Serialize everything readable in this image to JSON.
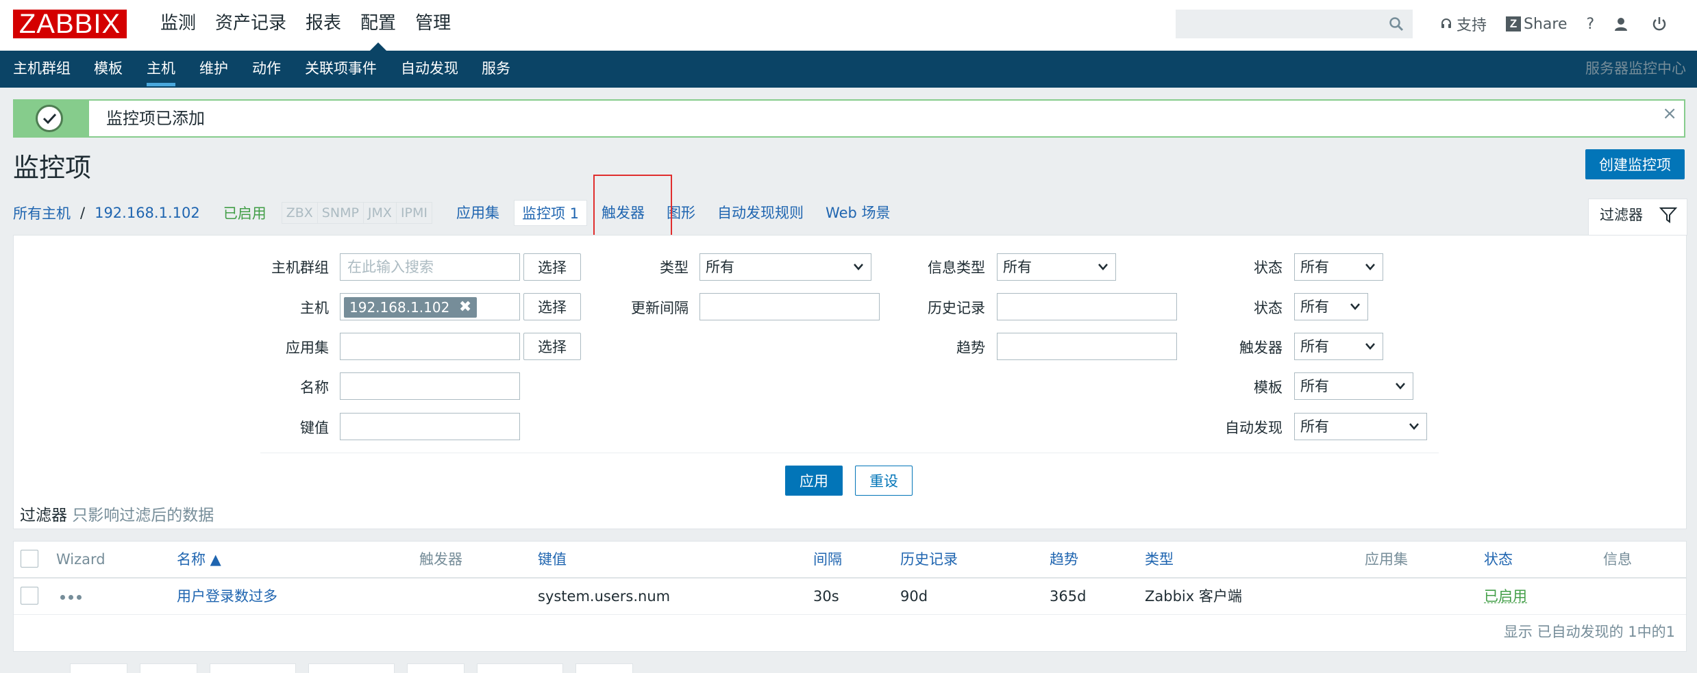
{
  "topbar": {
    "logo": "ZABBIX",
    "menu": [
      "监测",
      "资产记录",
      "报表",
      "配置",
      "管理"
    ],
    "search_placeholder": "",
    "support": "支持",
    "share": "Share",
    "help": "?"
  },
  "subnav": {
    "items": [
      "主机群组",
      "模板",
      "主机",
      "维护",
      "动作",
      "关联项事件",
      "自动发现",
      "服务"
    ],
    "active": "主机",
    "server": "服务器监控中心"
  },
  "message": {
    "text": "监控项已添加",
    "close": "×"
  },
  "page": {
    "title": "监控项",
    "create_button": "创建监控项"
  },
  "crumbs": {
    "all_hosts": "所有主机",
    "sep": "/",
    "host": "192.168.1.102",
    "enabled": "已启用",
    "protocols": [
      "ZBX",
      "SNMP",
      "JMX",
      "IPMI"
    ],
    "tabs": [
      "应用集",
      "监控项 1",
      "触发器",
      "图形",
      "自动发现规则",
      "Web 场景"
    ],
    "filter_tab": "过滤器"
  },
  "filter": {
    "host_group_label": "主机群组",
    "host_group_placeholder": "在此输入搜索",
    "select": "选择",
    "host_label": "主机",
    "host_chip": "192.168.1.102",
    "host_chip_remove": "✖",
    "app_label": "应用集",
    "name_label": "名称",
    "key_label": "键值",
    "type_label": "类型",
    "type_value": "所有",
    "interval_label": "更新间隔",
    "info_type_label": "信息类型",
    "info_type_value": "所有",
    "history_label": "历史记录",
    "trends_label": "趋势",
    "state_label": "状态",
    "state_value": "所有",
    "status_label": "状态",
    "status_value": "所有",
    "triggers_label": "触发器",
    "triggers_value": "所有",
    "template_label": "模板",
    "template_value": "所有",
    "discovery_label": "自动发现",
    "discovery_value": "所有",
    "apply": "应用",
    "reset": "重设",
    "note_bold": "过滤器",
    "note_rest": " 只影响过滤后的数据"
  },
  "table": {
    "headers": {
      "wizard": "Wizard",
      "name": "名称 ▲",
      "triggers": "触发器",
      "key": "键值",
      "interval": "间隔",
      "history": "历史记录",
      "trends": "趋势",
      "type": "类型",
      "applications": "应用集",
      "status": "状态",
      "info": "信息"
    },
    "rows": [
      {
        "name": "用户登录数过多",
        "key": "system.users.num",
        "interval": "30s",
        "history": "90d",
        "trends": "365d",
        "type": "Zabbix 客户端",
        "status": "已启用"
      }
    ],
    "footer": "显示 已自动发现的 1中的1"
  },
  "colors": {
    "brand_red": "#d40000",
    "nav_blue": "#0b4466",
    "link_blue": "#1f65b0",
    "button_blue": "#0275b8",
    "ok_green": "#86cc8c",
    "enabled_green": "#429e47",
    "highlight_red": "#e02d2d"
  }
}
